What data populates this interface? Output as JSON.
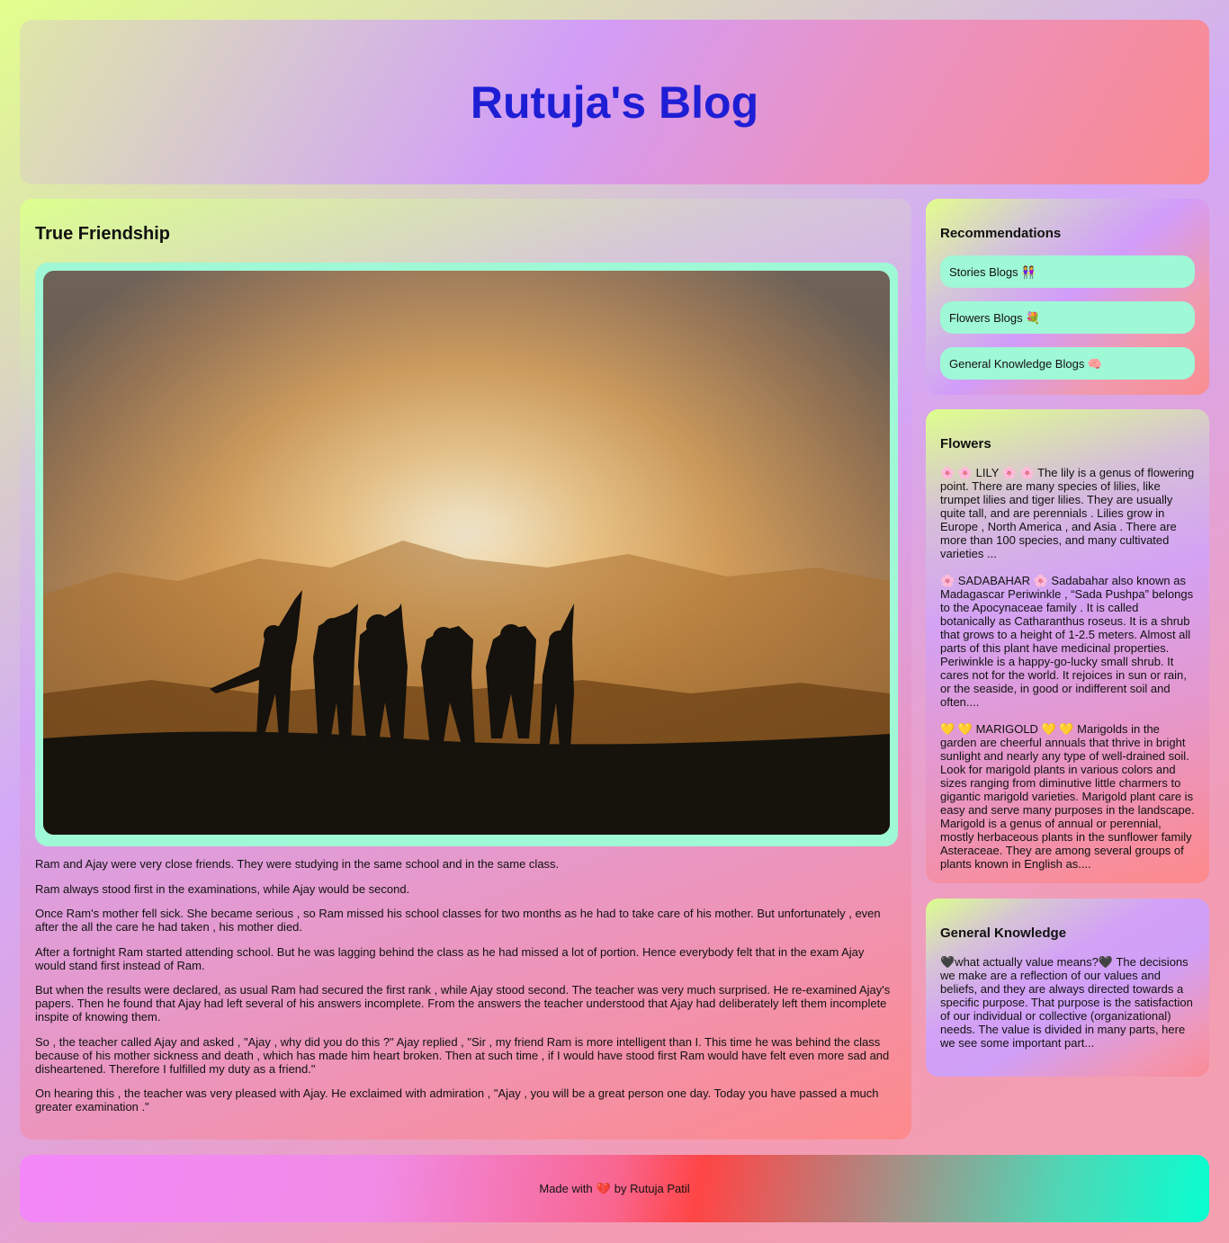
{
  "header": {
    "title": "Rutuja's Blog"
  },
  "main": {
    "post_title": "True Friendship",
    "paragraphs": [
      "Ram and Ajay were very close friends. They were studying in the same school and in the same class.",
      "Ram always stood first in the examinations, while Ajay would be second.",
      "Once Ram's mother fell sick. She became serious , so Ram missed his school classes for two months as he had to take care of his mother. But unfortunately , even after the all the care he had taken , his mother died.",
      "After a fortnight Ram started attending school. But he was lagging behind the class as he had missed a lot of portion. Hence everybody felt that in the exam Ajay would stand first instead of Ram.",
      "But when the results were declared, as usual Ram had secured the first rank , while Ajay stood second. The teacher was very much surprised. He re-examined Ajay's papers. Then he found that Ajay had left several of his answers incomplete. From the answers the teacher understood that Ajay had deliberately left them incomplete inspite of knowing them.",
      "So , the teacher called Ajay and asked , \"Ajay , why did you do this ?\" Ajay replied , \"Sir , my friend Ram is more intelligent than I. This time he was behind the class because of his mother sickness and death , which has made him heart broken. Then at such time , if I would have stood first Ram would have felt even more sad and disheartened. Therefore I fulfilled my duty as a friend.\"",
      "On hearing this , the teacher was very pleased with Ajay. He exclaimed with admiration , \"Ajay , you will be a great person one day. Today you have passed a much greater examination .\""
    ]
  },
  "recommendations": {
    "heading": "Recommendations",
    "items": [
      "Stories Blogs 👭",
      "Flowers Blogs 💐",
      "General Knowledge Blogs 🧠"
    ]
  },
  "flowers": {
    "heading": "Flowers",
    "paragraphs": [
      "🌸 🌸 LILY 🌸 🌸 The lily is a genus of flowering point. There are many species of lilies, like trumpet lilies and tiger lilies. They are usually quite tall, and are perennials . Lilies grow in Europe , North America , and Asia . There are more than 100 species, and many cultivated varieties ...",
      "🌸 SADABAHAR 🌸 Sadabahar also known as Madagascar Periwinkle , “Sada Pushpa” belongs to the Apocynaceae family . It is called botanically as Catharanthus roseus. It is a shrub that grows to a height of 1-2.5 meters. Almost all parts of this plant have medicinal properties. Periwinkle is a happy-go-lucky small shrub. It cares not for the world. It rejoices in sun or rain, or the seaside, in good or indifferent soil and often....",
      "💛 💛 MARIGOLD 💛 💛 Marigolds in the garden are cheerful annuals that thrive in bright sunlight and nearly any type of well-drained soil. Look for marigold plants in various colors and sizes ranging from diminutive little charmers to gigantic marigold varieties. Marigold plant care is easy and serve many purposes in the landscape. Marigold is a genus of annual or perennial, mostly herbaceous plants in the sunflower family Asteraceae. They are among several groups of plants known in English as...."
    ]
  },
  "gk": {
    "heading": "General Knowledge",
    "text": "🖤what actually value means?🖤 The decisions we make are a reflection of our values and beliefs, and they are always directed towards a specific purpose. That purpose is the satisfaction of our individual or collective (organizational) needs. The value is divided in many parts, here we see some important part..."
  },
  "footer": {
    "prefix": "Made with",
    "heart": "💔",
    "suffix": "by Rutuja Patil"
  }
}
